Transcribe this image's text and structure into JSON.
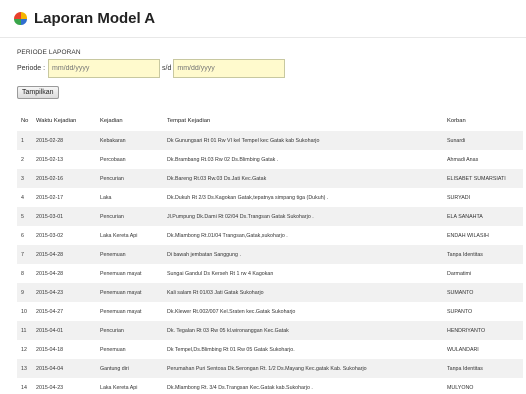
{
  "header": {
    "title": "Laporan Model A",
    "logo_icon": "google-style-logo-icon"
  },
  "filter": {
    "section_label": "PERIODE LAPORAN",
    "periode_label": "Periode :",
    "start_placeholder": "mm/dd/yyyy",
    "sd_label": "s/d",
    "end_placeholder": "mm/dd/yyyy",
    "button_label": "Tampilkan"
  },
  "table": {
    "headers": [
      "No",
      "Waktu Kejadian",
      "Kejadian",
      "Tempat Kejadian",
      "Korban"
    ],
    "rows": [
      [
        "1",
        "2015-02-28",
        "Kebakaran",
        "Dk Gunungsari Rt 01 Rw VI kel Tempel kec Gatak kab Sukoharjo",
        "Sunardi"
      ],
      [
        "2",
        "2015-02-13",
        "Percobaan",
        "Dk.Brambang Rt.03 Rw 02 Ds.Blimbing Gatak .",
        "Ahmadi Anas"
      ],
      [
        "3",
        "2015-02-16",
        "Pencurian",
        "Dk.Bareng Rt.03 Rw.03 Ds.Jati Kec.Gatak",
        "ELISABET SUMARSIATI"
      ],
      [
        "4",
        "2015-02-17",
        "Laka",
        "Dk.Dukuh Rt 2/3 Ds.Kagokan Gatak,tepatnya simpang tiga (Dukuh) .",
        "SURYADI"
      ],
      [
        "5",
        "2015-03-01",
        "Pencurian",
        "Jl.Pumpung Dk.Dami Rt 02/04 Ds.Trangsan Gatak Sukoharjo .",
        "ELA SANAHTA"
      ],
      [
        "6",
        "2015-03-02",
        "Laka Kereta Api",
        "Dk.Mlambong Rt.01/04 Trangsan,Gatak,sukoharjo .",
        "ENDAH WILASIH"
      ],
      [
        "7",
        "2015-04-28",
        "Penemuan",
        "Di bawah jembatan Sanggung .",
        "Tanpa Identitas"
      ],
      [
        "8",
        "2015-04-28",
        "Penemuan mayat",
        "Sungai Gandul Ds Kerseh Rt 1 rw 4 Kagokan",
        "Darmatimi"
      ],
      [
        "9",
        "2015-04-23",
        "Penemuan mayat",
        "Kali salam Rt 01/03 Jati Gatak Sukoharjo",
        "SUMANTO"
      ],
      [
        "10",
        "2015-04-27",
        "Penemuan mayat",
        "Dk.Klewer Rt.002/007 Kel.Sraten kec.Gatak Sukoharjo",
        "SUPANTO"
      ],
      [
        "11",
        "2015-04-01",
        "Pencurian",
        "Dk. Tegalan Rt 03 Rw 05 kl.wironanggan Kec.Gatak",
        "HENDRIYANTO"
      ],
      [
        "12",
        "2015-04-18",
        "Penemuan",
        "Dk Tempel,Ds.Blimbing Rt 01 Rw 05 Gatak Sukoharjo.",
        "WULANDARI"
      ],
      [
        "13",
        "2015-04-04",
        "Gantung diri",
        "Perumahan Puri Sentosa Dk.Serongan Rt. 1/2 Ds.Mayang Kec.gatak Kab. Sukoharjo",
        "Tanpa Identitas"
      ],
      [
        "14",
        "2015-04-23",
        "Laka Kereta Api",
        "Dk.Mlambong Rt. 3/4 Ds.Trangsan Kec.Gatak kab.Sukoharjo .",
        "MULYONO"
      ]
    ]
  }
}
